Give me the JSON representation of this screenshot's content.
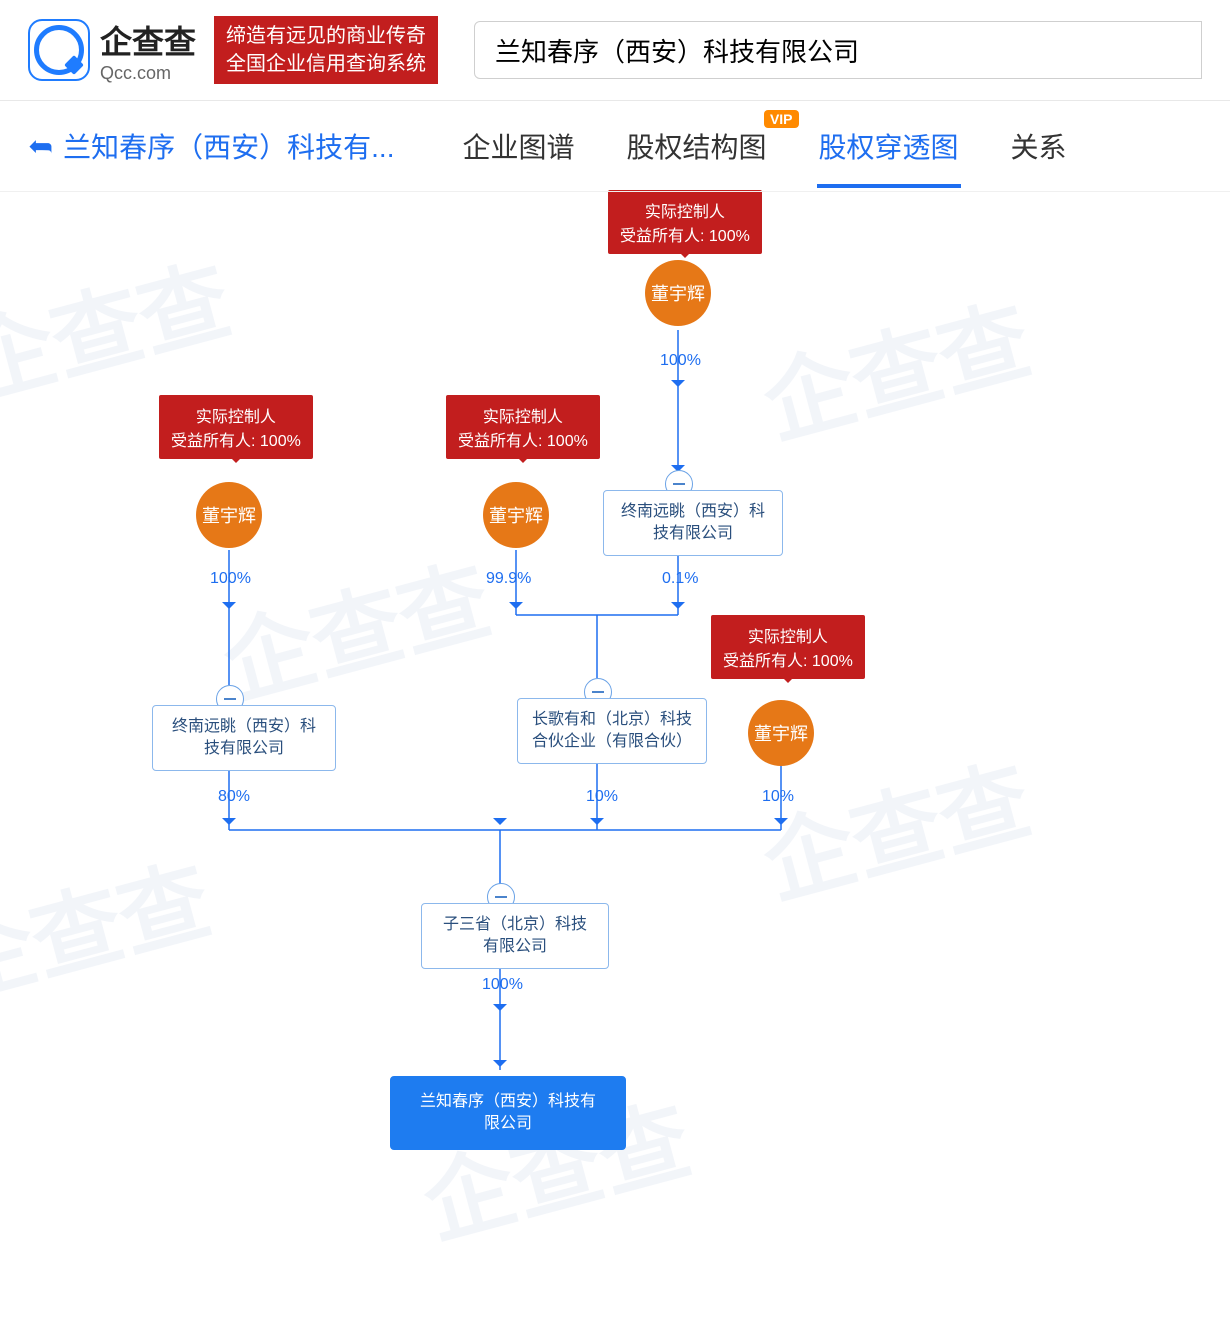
{
  "header": {
    "brand": "企查查",
    "brand_domain": "Qcc.com",
    "slogan_line1": "缔造有远见的商业传奇",
    "slogan_line2": "全国企业信用查询系统",
    "search_value": "兰知春序（西安）科技有限公司"
  },
  "subnav": {
    "back_label": "兰知春序（西安）科技有...",
    "tabs": [
      {
        "id": "qiyitu",
        "label": "企业图谱"
      },
      {
        "id": "guquan-jiegou",
        "label": "股权结构图",
        "vip": "VIP"
      },
      {
        "id": "guquan-chuantou",
        "label": "股权穿透图",
        "active": true
      },
      {
        "id": "guanxi",
        "label": "关系"
      }
    ]
  },
  "chart_data": {
    "type": "tree",
    "title": "股权穿透图",
    "labels": {
      "controller": "实际控制人",
      "beneficiary": "受益所有人",
      "beneficiary_pct": "100%"
    },
    "people": {
      "dyh": {
        "name": "董宇辉"
      }
    },
    "companies": {
      "zhongnan": {
        "name": "终南远眺（西安）科技有限公司"
      },
      "changge": {
        "name": "长歌有和（北京）科技合伙企业（有限合伙）"
      },
      "zisan": {
        "name": "子三省（北京）科技有限公司"
      },
      "lanzhi": {
        "name": "兰知春序（西安）科技有限公司"
      }
    },
    "edges": [
      {
        "from": "dyh_top",
        "to": "zhongnan_top",
        "pct": "100%"
      },
      {
        "from": "dyh_left",
        "to": "zhongnan_left",
        "pct": "100%"
      },
      {
        "from": "dyh_mid",
        "to": "changge",
        "pct": "99.9%"
      },
      {
        "from": "zhongnan_top",
        "to": "changge",
        "pct": "0.1%"
      },
      {
        "from": "zhongnan_left",
        "to": "zisan",
        "pct": "80%"
      },
      {
        "from": "changge",
        "to": "zisan",
        "pct": "10%"
      },
      {
        "from": "dyh_right",
        "to": "zisan",
        "pct": "10%"
      },
      {
        "from": "zisan",
        "to": "lanzhi",
        "pct": "100%"
      }
    ]
  }
}
